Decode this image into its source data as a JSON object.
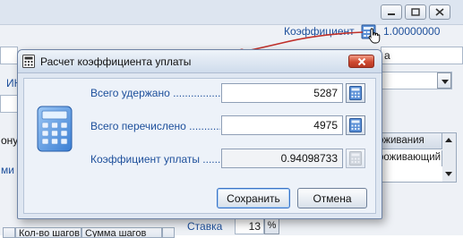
{
  "background": {
    "coefficient_label": "Коэффициент",
    "coefficient_value": "1.00000000",
    "left_text_1": "ИН",
    "left_text_2": "ону",
    "left_text_3": "ми R",
    "right_field_text": "а",
    "grid_header": "оживания",
    "grid_cell": "роживающий",
    "rate_label": "Ставка",
    "rate_value": "13",
    "percent_button": "%",
    "bottom_tabs": [
      "Кол-во шагов",
      "Сумма шагов"
    ]
  },
  "dialog": {
    "title": "Расчет коэффициента уплаты",
    "fields": [
      {
        "label": "Всего удержано ..........................",
        "value": "5287"
      },
      {
        "label": "Всего перечислено ......................",
        "value": "4975"
      },
      {
        "label": "Коэффициент уплаты ......................",
        "value": "0.94098733"
      }
    ],
    "save_button": "Сохранить",
    "cancel_button": "Отмена"
  }
}
